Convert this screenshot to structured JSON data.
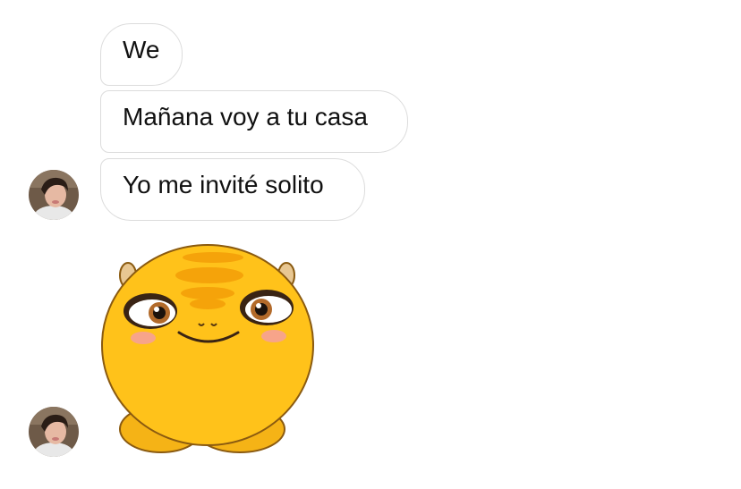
{
  "conversation": {
    "messages": [
      {
        "text": "We"
      },
      {
        "text": "Mañana voy a tu casa"
      },
      {
        "text": "Yo me invité solito"
      }
    ],
    "sticker": {
      "icon": "yellow-creature-sticker-icon"
    },
    "avatar": {
      "icon": "user-avatar-icon"
    }
  },
  "colors": {
    "bubble_border": "#dcdcdc",
    "bubble_text": "#111111",
    "sticker_yellow": "#ffc21a",
    "sticker_orange": "#f5a30a"
  }
}
